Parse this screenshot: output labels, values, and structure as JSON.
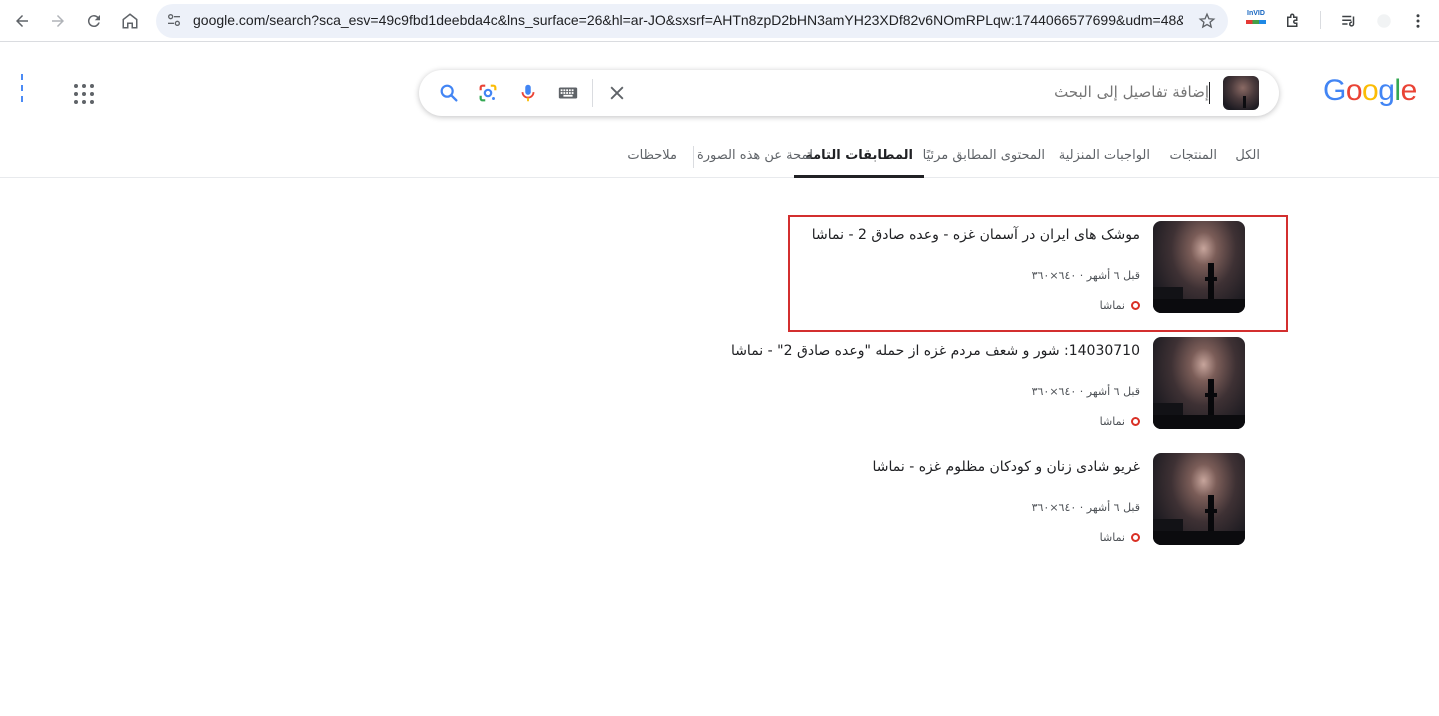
{
  "browser": {
    "url": "google.com/search?sca_esv=49c9fbd1deebda4c&lns_surface=26&hl=ar-JO&sxsrf=AHTn8zpD2bHN3amYH23XDf82v6NOmRPLqw:1744066577699&udm=48&...",
    "extension_label": "InVID"
  },
  "logo": {
    "G": "G",
    "o1": "o",
    "o2": "o",
    "g": "g",
    "l": "l",
    "e": "e"
  },
  "search": {
    "placeholder": "إضافة تفاصيل إلى البحث"
  },
  "tabs": [
    {
      "label": "الكل"
    },
    {
      "label": "المنتجات"
    },
    {
      "label": "الواجبات المنزلية"
    },
    {
      "label": "المحتوى المطابق مرئيًا"
    },
    {
      "label": "المطابقات التامة"
    },
    {
      "label": "لمحة عن هذه الصورة"
    },
    {
      "label": "ملاحظات"
    }
  ],
  "results": [
    {
      "title": "موشک های ایران در آسمان غزه - وعده صادق 2 - نماشا",
      "meta": "قبل ٦ أشهر · ٦٤٠×٣٦٠",
      "source": "نماشا"
    },
    {
      "title": "14030710: شور و شعف مردم غزه از حمله \"وعده صادق 2\" - نماشا",
      "meta": "قبل ٦ أشهر · ٦٤٠×٣٦٠",
      "source": "نماشا"
    },
    {
      "title": "غریو شادی زنان و کودکان مظلوم غزه - نماشا",
      "meta": "قبل ٦ أشهر · ٦٤٠×٣٦٠",
      "source": "نماشا"
    }
  ],
  "colors": {
    "highlight_border": "#d32f2f",
    "favicon": "#d93025"
  }
}
